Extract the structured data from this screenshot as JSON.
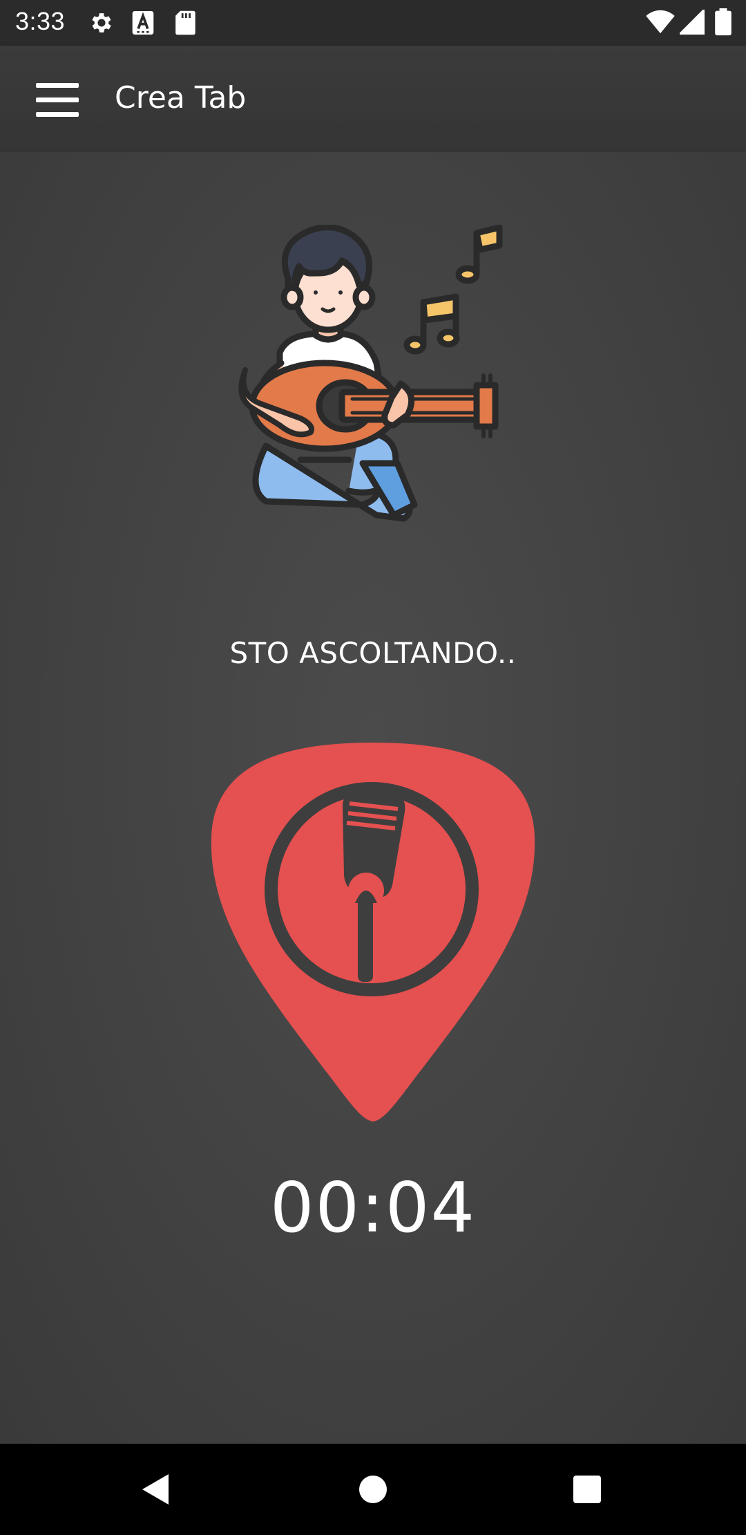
{
  "status_bar": {
    "time": "3:33",
    "left_icons": [
      "settings-icon",
      "font-icon",
      "sd-card-icon"
    ],
    "right_icons": [
      "wifi-icon",
      "signal-icon",
      "battery-icon"
    ]
  },
  "app_bar": {
    "title": "Crea Tab",
    "menu_icon": "hamburger-menu-icon"
  },
  "main": {
    "illustration": "guitar-player-illustration",
    "status_text": "STO ASCOLTANDO..",
    "record_button_icon": "microphone-icon",
    "timer": "00:04"
  },
  "colors": {
    "accent": "#e65050",
    "background": "#454545",
    "app_bar": "#383838",
    "status_bar": "#2b2b2b",
    "nav_bar": "#000000",
    "text": "#ffffff"
  },
  "nav_bar": {
    "back_icon": "back-triangle-icon",
    "home_icon": "home-circle-icon",
    "recents_icon": "recents-square-icon"
  }
}
